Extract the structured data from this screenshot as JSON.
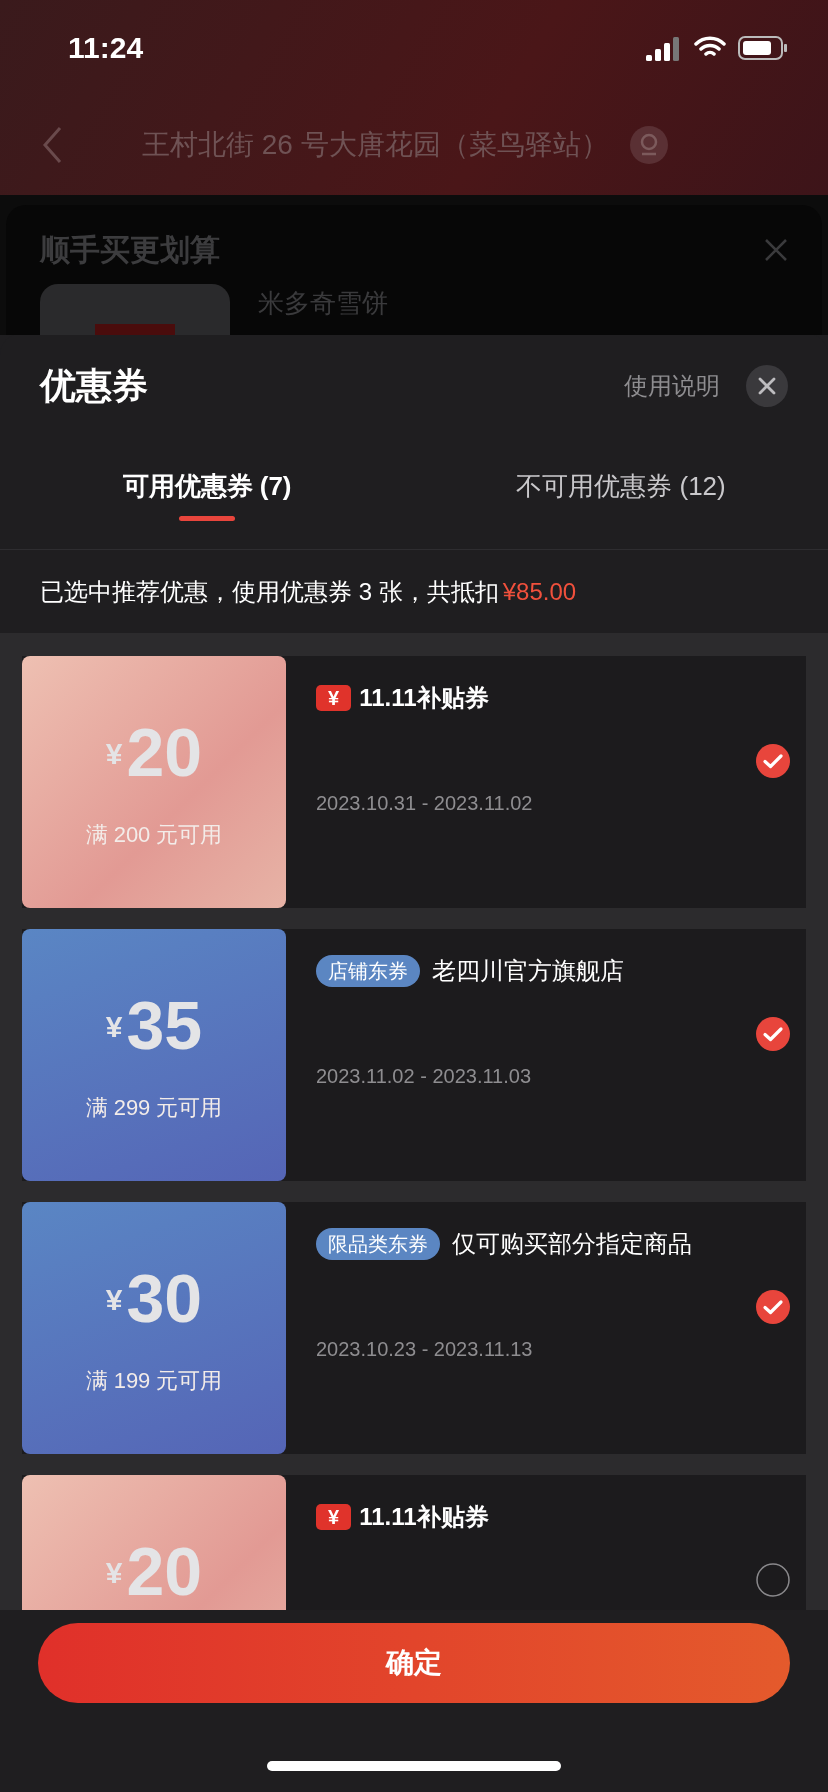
{
  "status_bar": {
    "time": "11:24"
  },
  "nav": {
    "address": "王村北街 26 号大唐花园（菜鸟驿站）"
  },
  "background_card": {
    "title": "顺手买更划算",
    "product_name": "米多奇雪饼"
  },
  "sheet": {
    "title": "优惠券",
    "help_link": "使用说明",
    "tabs": [
      {
        "label": "可用优惠券 (7)",
        "selected": true
      },
      {
        "label": "不可用优惠券 (12)",
        "selected": false
      }
    ],
    "summary": {
      "text": "已选中推荐优惠，使用优惠券 3 张，共抵扣",
      "amount": "¥85.00"
    },
    "coupons": [
      {
        "kind": "festival",
        "currency": "¥",
        "amount": "20",
        "condition": "满 200 元可用",
        "badge": "¥",
        "brand": "11.11补贴券",
        "dates": "2023.10.31 - 2023.11.02",
        "selected": true
      },
      {
        "kind": "tag",
        "currency": "¥",
        "amount": "35",
        "condition": "满 299 元可用",
        "tag": "店铺东券",
        "title": "老四川官方旗舰店",
        "dates": "2023.11.02 - 2023.11.03",
        "selected": true
      },
      {
        "kind": "tag",
        "currency": "¥",
        "amount": "30",
        "condition": "满 199 元可用",
        "tag": "限品类东券",
        "title": "仅可购买部分指定商品",
        "dates": "2023.10.23 - 2023.11.13",
        "selected": true
      },
      {
        "kind": "festival",
        "currency": "¥",
        "amount": "20",
        "badge": "¥",
        "brand": "11.11补贴券",
        "selected": false
      }
    ],
    "confirm_button": "确定"
  }
}
